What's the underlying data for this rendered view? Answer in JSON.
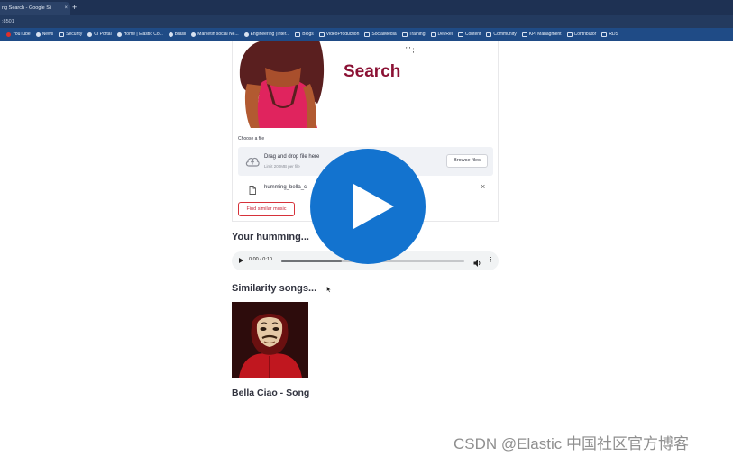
{
  "browser": {
    "tab_title": "ng Search - Google Sli",
    "tab_close": "×",
    "new_tab": "+",
    "address": ":8501",
    "bookmarks": [
      "YouTube",
      "News",
      "Security",
      "CI Portal",
      "Home | Elastic Co...",
      "Brasil",
      "Marketin social Ne...",
      "Engineering (Inter...",
      "Blogs",
      "VideoProduction",
      "SocialMedia",
      "Training",
      "DevRel",
      "Content",
      "Community",
      "KPI Managment",
      "Contributor",
      "RDS"
    ]
  },
  "app": {
    "title_line2": "Search",
    "title_fragment": "' ' ;",
    "uploader": {
      "label": "Choose a file",
      "drop_title": "Drag and drop file here",
      "drop_limit": "Limit 200MB per file",
      "browse_label": "Browse files",
      "uploaded_file": "humming_bella_ci",
      "remove_symbol": "×"
    },
    "find_button": "Find similar music",
    "humming_heading": "Your humming...",
    "audio": {
      "time": "0:00 / 0:10",
      "progress_fraction": 0.33,
      "menu_symbol": "⋮"
    },
    "similarity_heading": "Similarity songs...",
    "results": [
      {
        "title": "Bella Ciao - Song"
      }
    ]
  },
  "watermark": "CSDN @Elastic 中国社区官方博客",
  "colors": {
    "accent_title": "#8b1134",
    "find_button_border": "#d6323a",
    "play_overlay": "#1373cf",
    "browser_bar": "#1e3153",
    "bookmarks_bar": "#1f4b86"
  }
}
